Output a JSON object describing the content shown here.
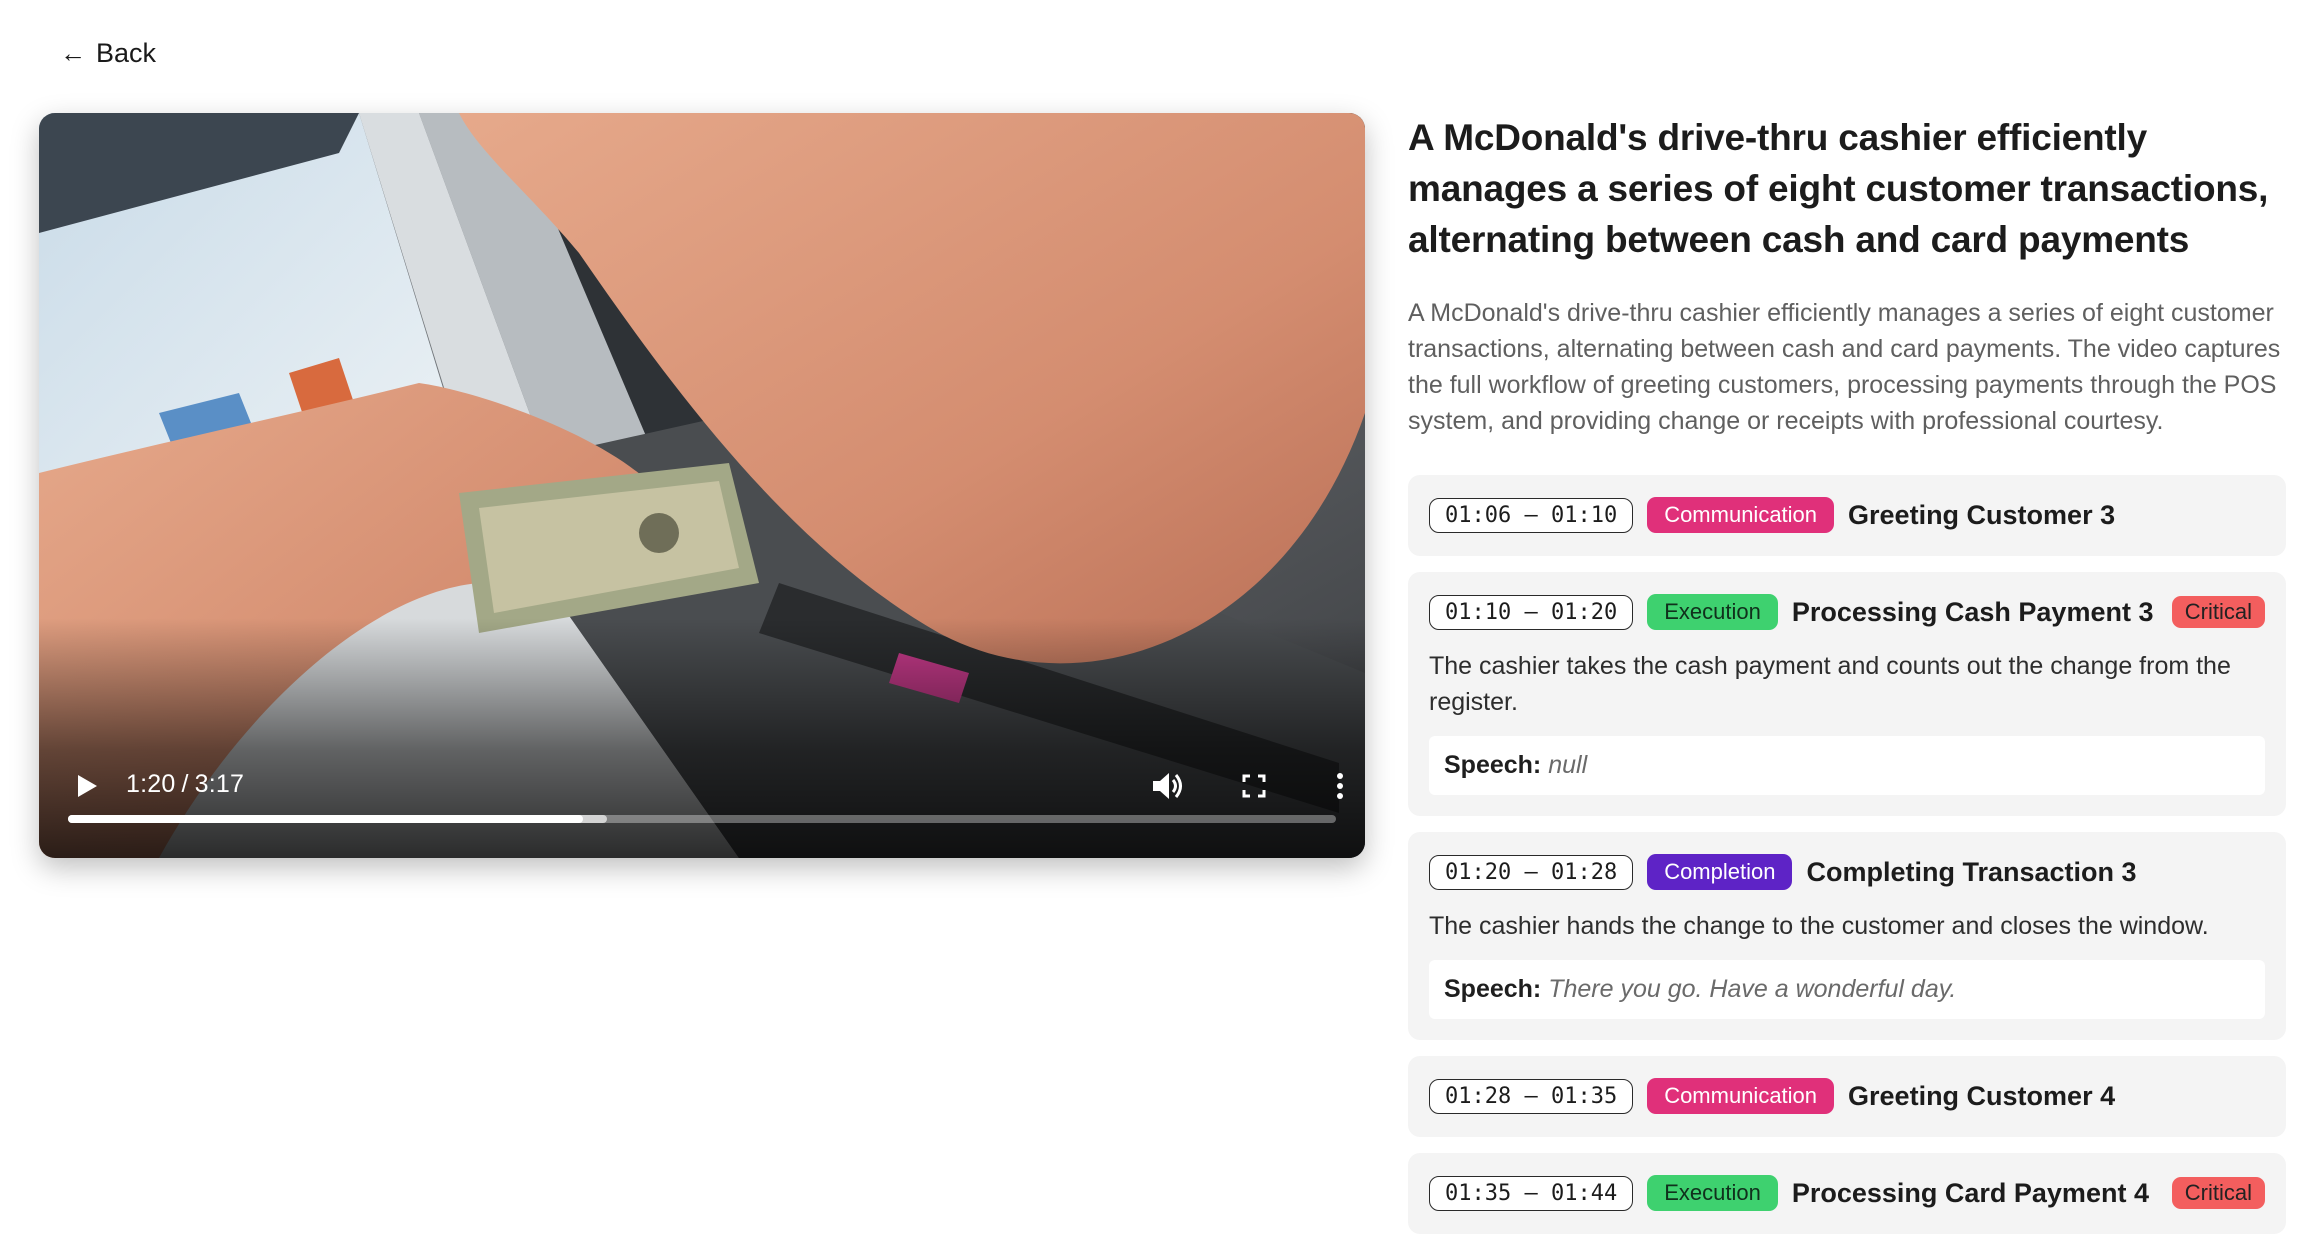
{
  "nav": {
    "back_label": "Back"
  },
  "video": {
    "current_time": "1:20",
    "duration": "3:17",
    "progress_fraction": 0.406,
    "buffered_fraction": 0.425
  },
  "summary": {
    "title": "A McDonald's drive-thru cashier efficiently manages a series of eight customer transactions, alternating between cash and card payments",
    "description": "A McDonald's drive-thru cashier efficiently manages a series of eight customer transactions, alternating between cash and card payments. The video captures the full workflow of greeting customers, processing payments through the POS system, and providing change or receipts with professional courtesy."
  },
  "speech_label": "Speech:",
  "events": [
    {
      "time": "01:06 – 01:10",
      "tag": "Communication",
      "tag_class": "communication",
      "title": "Greeting Customer 3",
      "critical": "",
      "body": "",
      "speech": ""
    },
    {
      "time": "01:10 – 01:20",
      "tag": "Execution",
      "tag_class": "execution",
      "title": "Processing Cash Payment 3",
      "critical": "Critical",
      "body": "The cashier takes the cash payment and counts out the change from the register.",
      "speech": "null"
    },
    {
      "time": "01:20 – 01:28",
      "tag": "Completion",
      "tag_class": "completion",
      "title": "Completing Transaction 3",
      "critical": "",
      "body": "The cashier hands the change to the customer and closes the window.",
      "speech": "There you go. Have a wonderful day."
    },
    {
      "time": "01:28 – 01:35",
      "tag": "Communication",
      "tag_class": "communication",
      "title": "Greeting Customer 4",
      "critical": "",
      "body": "",
      "speech": ""
    },
    {
      "time": "01:35 – 01:44",
      "tag": "Execution",
      "tag_class": "execution",
      "title": "Processing Card Payment 4",
      "critical": "Critical",
      "body": "",
      "speech": ""
    }
  ],
  "colors": {
    "communication": "#e0307a",
    "execution": "#3ed16f",
    "completion": "#5e23c6",
    "critical": "#f35e5e"
  },
  "icons": [
    "arrow-left-icon",
    "play-icon",
    "volume-icon",
    "fullscreen-icon",
    "more-vert-icon"
  ]
}
